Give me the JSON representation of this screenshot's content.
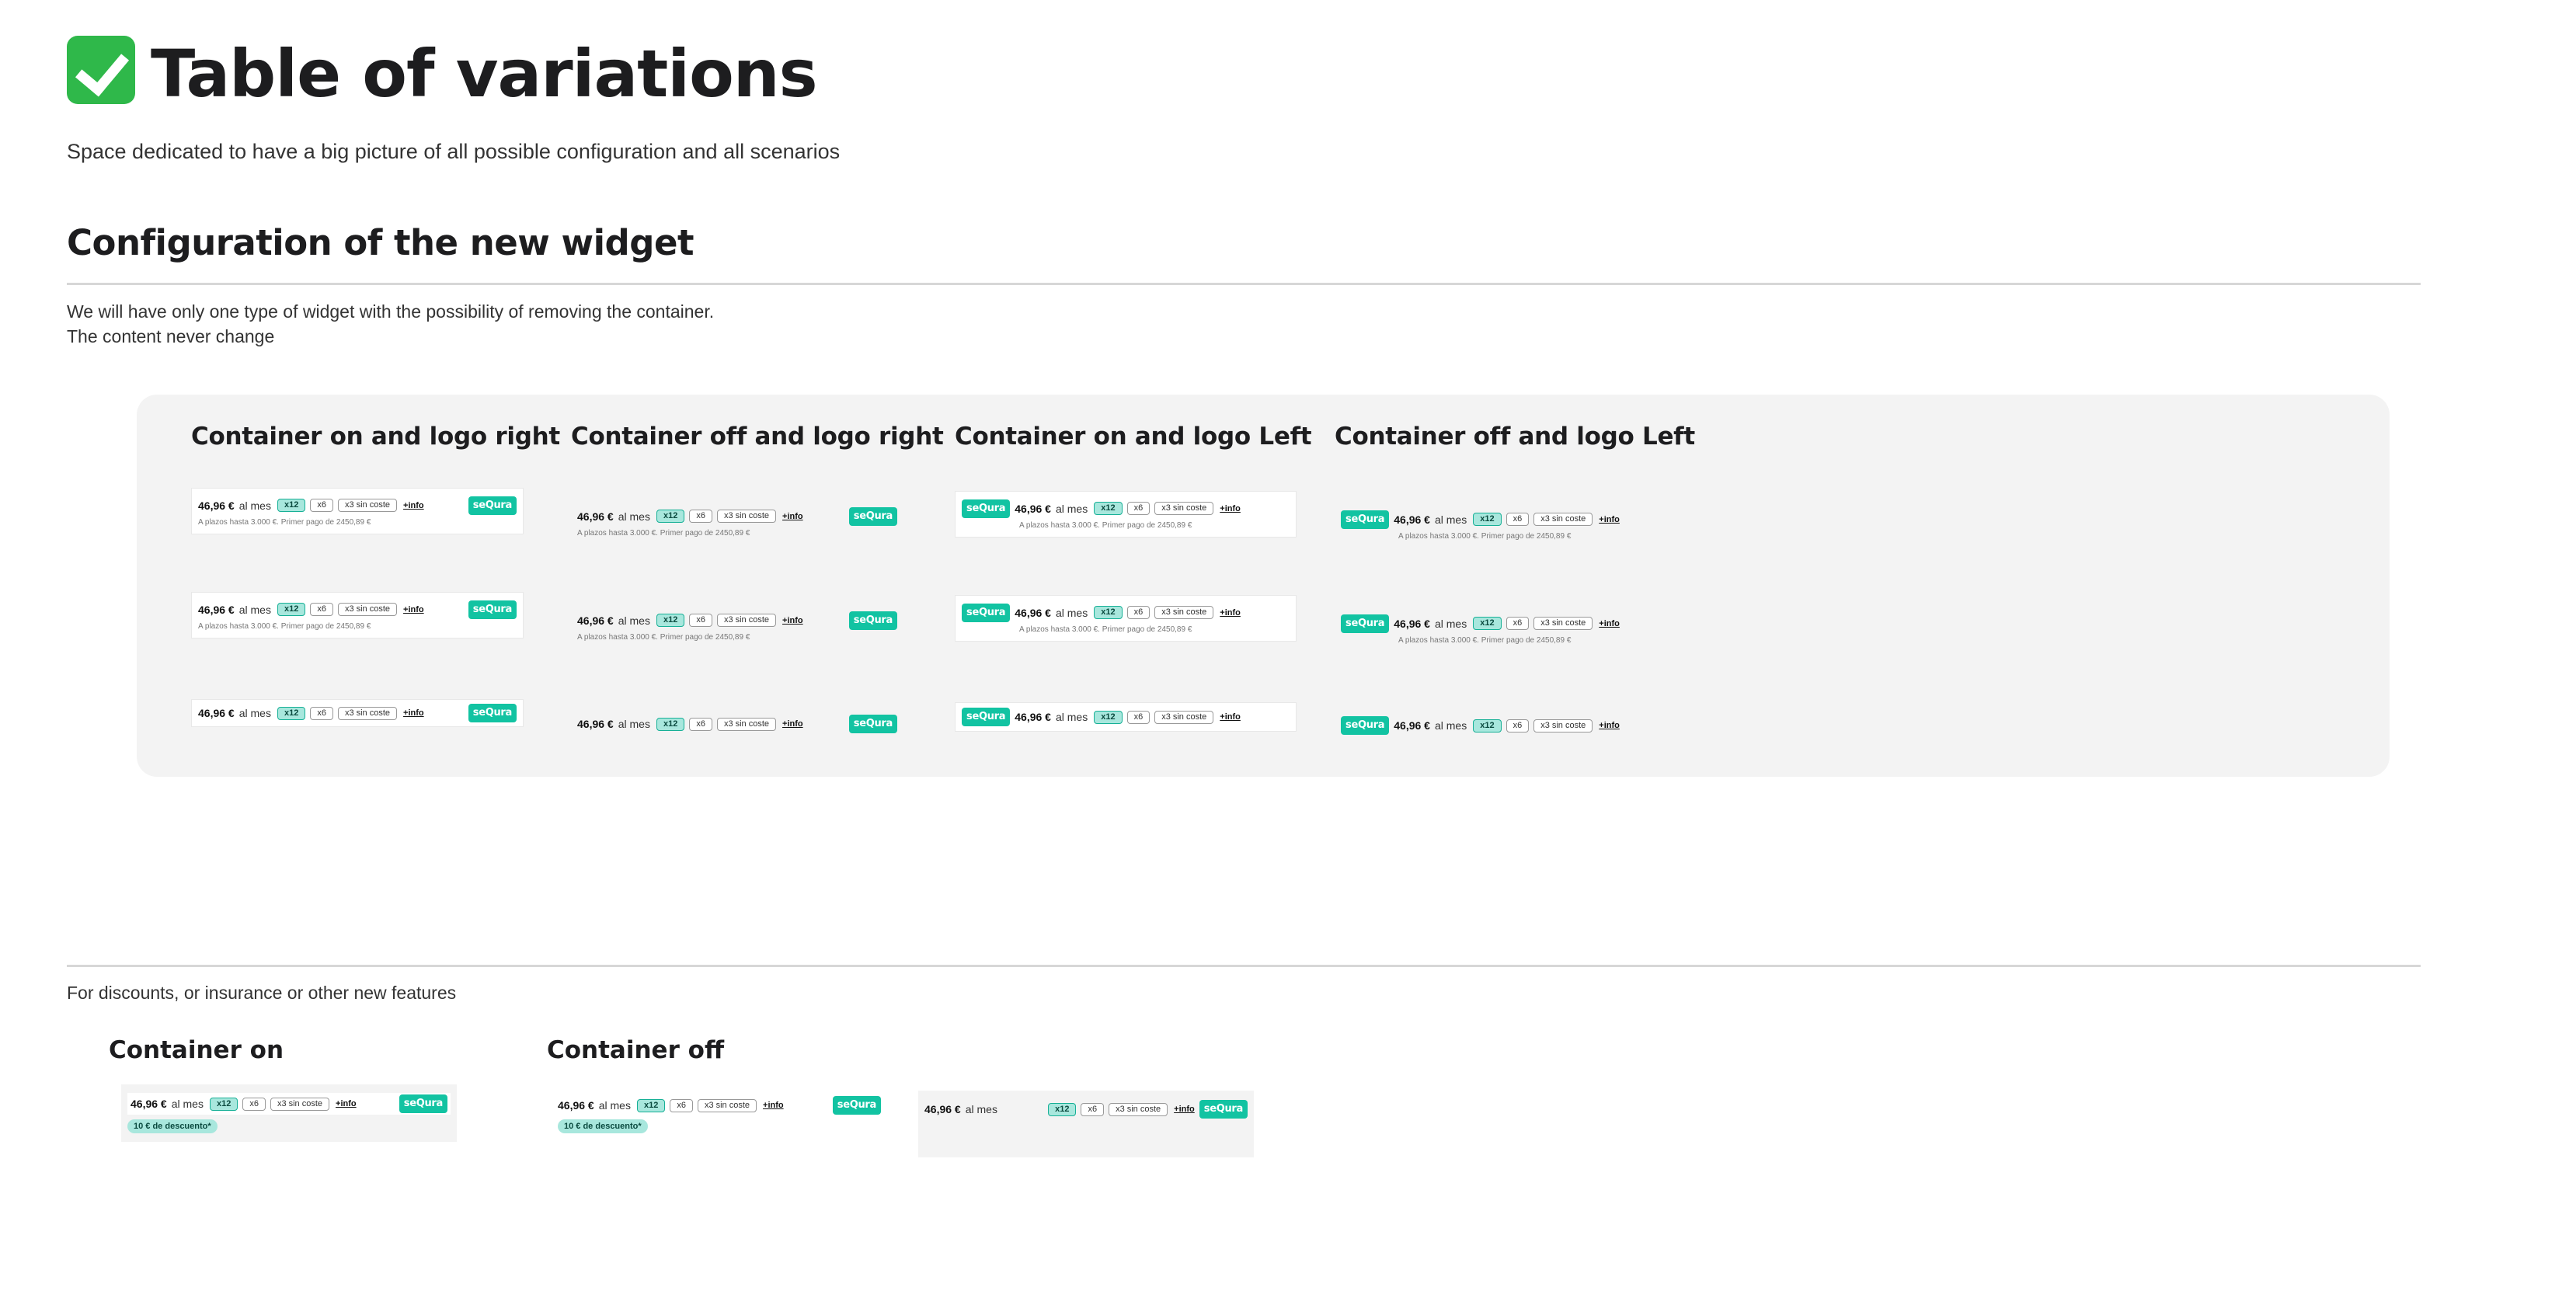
{
  "header": {
    "title": "Table of variations",
    "subtitle": "Space dedicated to have a big picture of all possible configuration and all scenarios"
  },
  "config_section": {
    "title": "Configuration of the new widget",
    "line1": "We will have only one type of widget with the possibility of removing the container.",
    "line2": "The content never change"
  },
  "columns": [
    {
      "title": "Container on and logo right"
    },
    {
      "title": "Container off and logo right"
    },
    {
      "title": "Container on and logo Left"
    },
    {
      "title": "Container off and logo Left"
    }
  ],
  "widget": {
    "amount": "46,96 €",
    "per_month": "al mes",
    "options": [
      "x12",
      "x6",
      "x3 sin coste"
    ],
    "selected_option": "x12",
    "more_info": "+info",
    "logo_text": "seQura",
    "note": "A plazos hasta 3.000 €. Primer pago de 2450,89 €",
    "brand_color": "#12c3a2",
    "selected_color": "#a8e7dd"
  },
  "features_section": {
    "text": "For discounts, or insurance or other new features",
    "container_on_title": "Container on",
    "container_off_title": "Container off",
    "promo": "10 € de descuento*"
  }
}
